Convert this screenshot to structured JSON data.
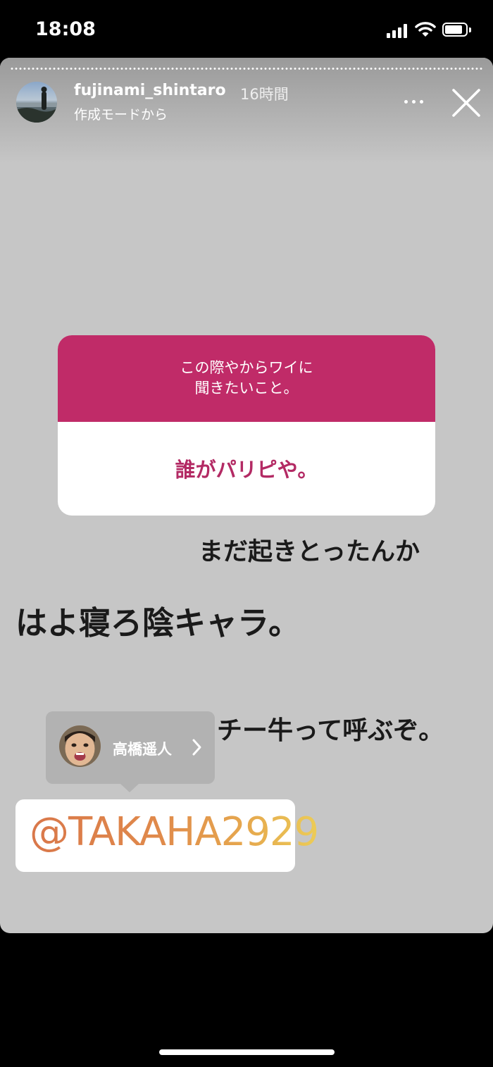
{
  "status_bar": {
    "time": "18:08",
    "icons": [
      "cellular-signal-icon",
      "wifi-icon",
      "battery-icon"
    ]
  },
  "story": {
    "username": "fujinami_shintaro",
    "time_ago": "16時間",
    "subtitle": "作成モードから",
    "icons": [
      "more-icon",
      "close-icon"
    ],
    "background_color": "#c6c6c6"
  },
  "question_sticker": {
    "prompt": "この際やからワイに\n聞きたいこと。",
    "answer": "誰がパリピや。",
    "accent_color": "#c02b68"
  },
  "overlay_texts": {
    "line1": "まだ起きとったんか",
    "line2": "はよ寝ろ陰キャラ。",
    "line3": "チー牛って呼ぶぞ。"
  },
  "mention_tooltip": {
    "name": "高橋遥人",
    "icon": "chevron-right-icon"
  },
  "mention_sticker": {
    "text": "@TAKAHA2929"
  }
}
